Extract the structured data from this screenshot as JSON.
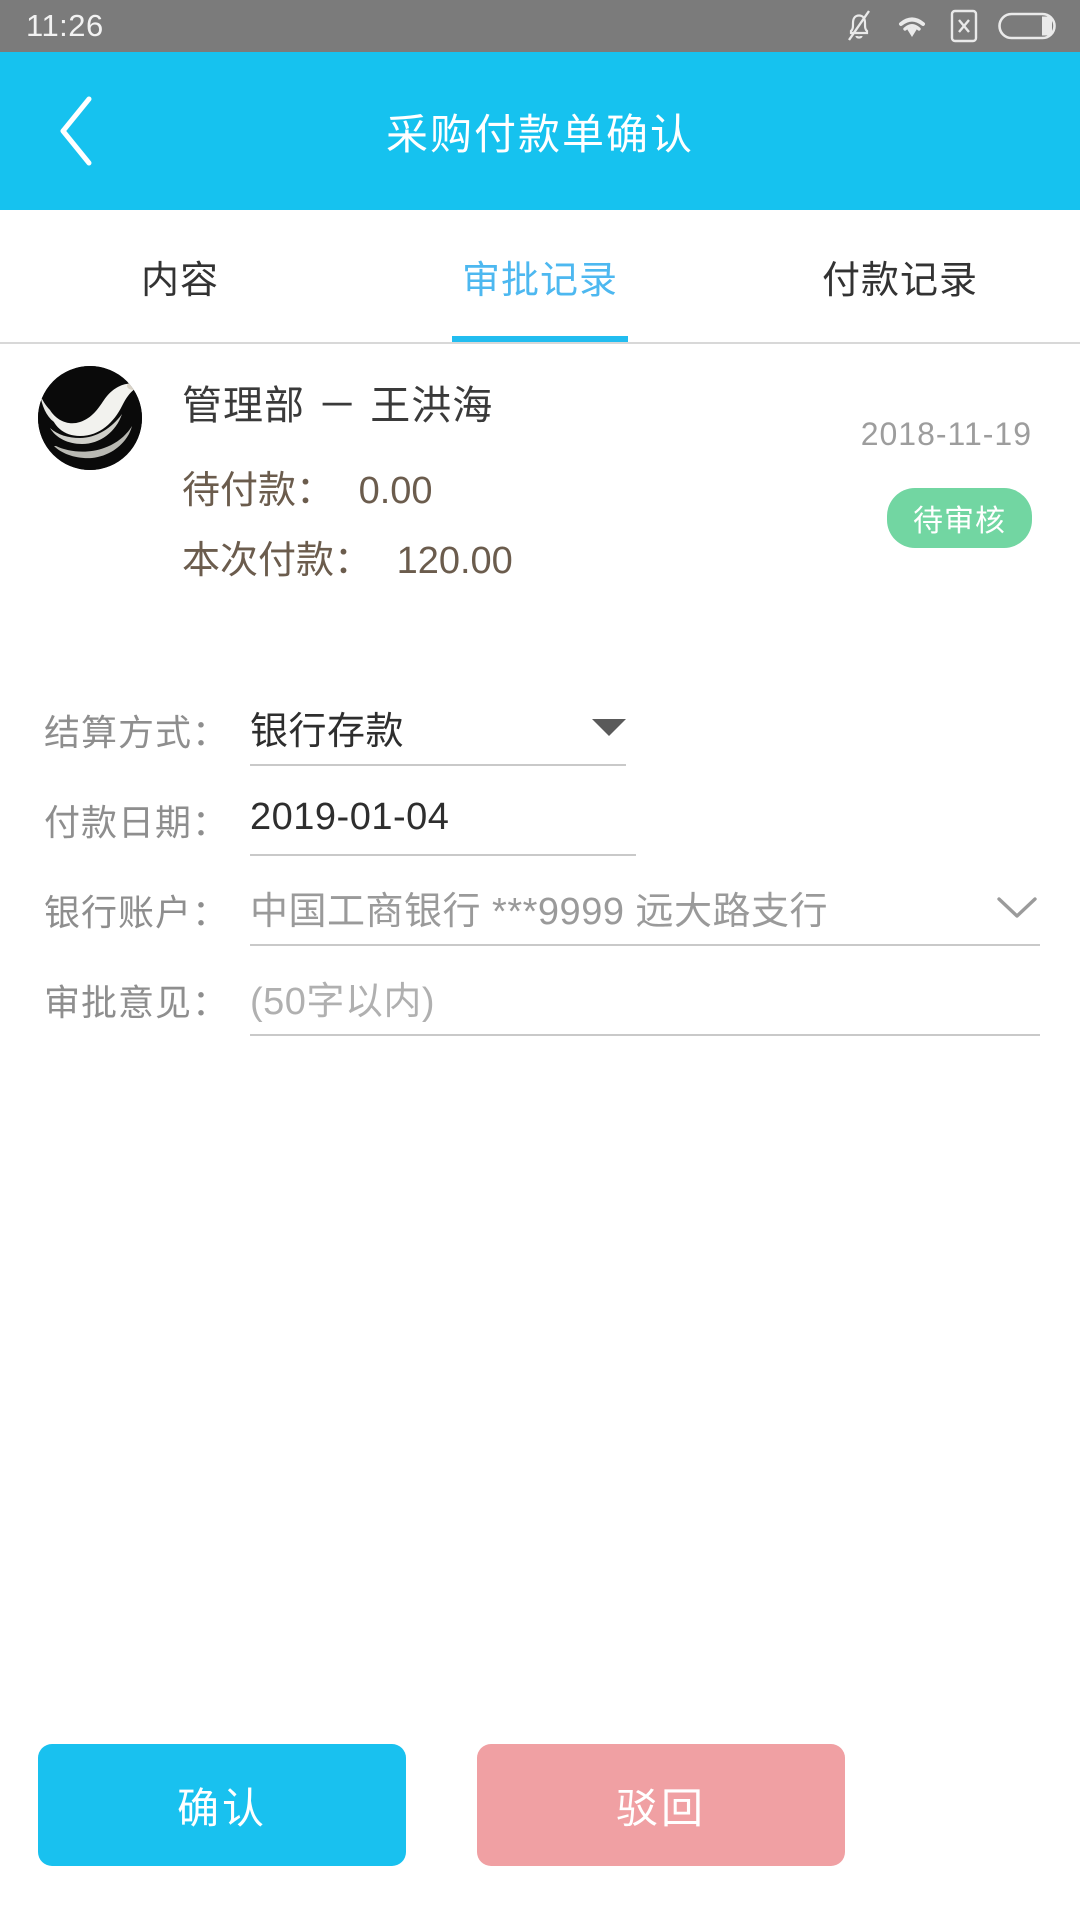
{
  "statusbar": {
    "time": "11:26",
    "icons": [
      "bell-muted-icon",
      "wifi-icon",
      "sim-x-icon",
      "battery-icon"
    ]
  },
  "titlebar": {
    "back_icon": "chevron-left-icon",
    "title": "采购付款单确认",
    "background": "#16c2ef"
  },
  "tabs": [
    {
      "label": "内容",
      "active": false
    },
    {
      "label": "审批记录",
      "active": true
    },
    {
      "label": "付款记录",
      "active": false
    }
  ],
  "record": {
    "avatar": "swan-photo-avatar",
    "person": "管理部 － 王洪海",
    "pending_label": "待付款：",
    "pending_value": "0.00",
    "current_label": "本次付款：",
    "current_value": "120.00",
    "date": "2018-11-19",
    "status": "待审核",
    "status_color": "#72d6a2"
  },
  "form": {
    "settlement": {
      "label": "结算方式：",
      "value": "银行存款",
      "icon": "caret-down-icon"
    },
    "payment_date": {
      "label": "付款日期：",
      "value": "2019-01-04"
    },
    "bank_account": {
      "label": "银行账户：",
      "value": "中国工商银行 ***9999 远大路支行",
      "icon": "chevron-down-icon"
    },
    "opinion": {
      "label": "审批意见：",
      "value": "",
      "placeholder": "(50字以内)"
    }
  },
  "buttons": {
    "confirm": {
      "label": "确认",
      "color": "#19c1ef"
    },
    "reject": {
      "label": "驳回",
      "color": "#f0a0a3"
    }
  }
}
